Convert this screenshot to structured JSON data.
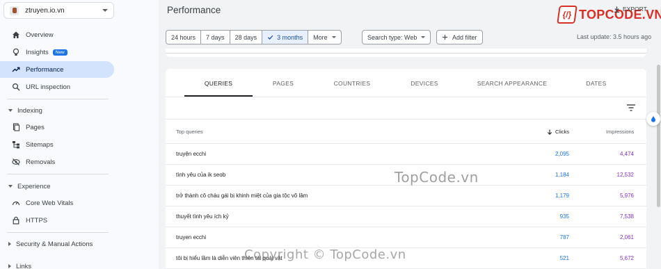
{
  "property": {
    "name": "ztruyen.io.vn"
  },
  "sidebar": {
    "overview": "Overview",
    "insights": "Insights",
    "insights_badge": "New",
    "performance": "Performance",
    "url_inspection": "URL inspection",
    "indexing": "Indexing",
    "pages": "Pages",
    "sitemaps": "Sitemaps",
    "removals": "Removals",
    "experience": "Experience",
    "core_web_vitals": "Core Web Vitals",
    "https": "HTTPS",
    "security": "Security & Manual Actions",
    "links": "Links"
  },
  "header": {
    "title": "Performance",
    "logo_text": "TOPCODE.VN",
    "export": "EXPORT"
  },
  "filters": {
    "ranges": [
      "24 hours",
      "7 days",
      "28 days",
      "3 months",
      "More"
    ],
    "selected": "3 months",
    "search_type": "Search type: Web",
    "add_filter": "Add filter",
    "last_update": "Last update: 3.5 hours ago"
  },
  "tabs": [
    "QUERIES",
    "PAGES",
    "COUNTRIES",
    "DEVICES",
    "SEARCH APPEARANCE",
    "DATES"
  ],
  "table": {
    "headers": {
      "query": "Top queries",
      "clicks": "Clicks",
      "impressions": "Impressions"
    },
    "rows": [
      {
        "query": "truyện ecchi",
        "clicks": "2,095",
        "impressions": "4,474"
      },
      {
        "query": "tình yêu của ik seob",
        "clicks": "1,184",
        "impressions": "12,532"
      },
      {
        "query": "trở thành cô cháu gái bị khinh miệt của gia tộc võ lâm",
        "clicks": "1,179",
        "impressions": "5,976"
      },
      {
        "query": "thuyết tình yêu ích kỷ",
        "clicks": "935",
        "impressions": "7,538"
      },
      {
        "query": "truyen ecchi",
        "clicks": "787",
        "impressions": "2,061"
      },
      {
        "query": "tôi bị hiểu lầm là diễn viên thiên tài quái vật",
        "clicks": "521",
        "impressions": "5,672"
      }
    ]
  },
  "watermarks": {
    "center": "TopCode.vn",
    "bottom": "Copyright © TopCode.vn"
  },
  "colors": {
    "accent": "#1a73e8",
    "impressions": "#8430ce",
    "active_nav": "#d3e3fd",
    "brand": "#d93025"
  }
}
